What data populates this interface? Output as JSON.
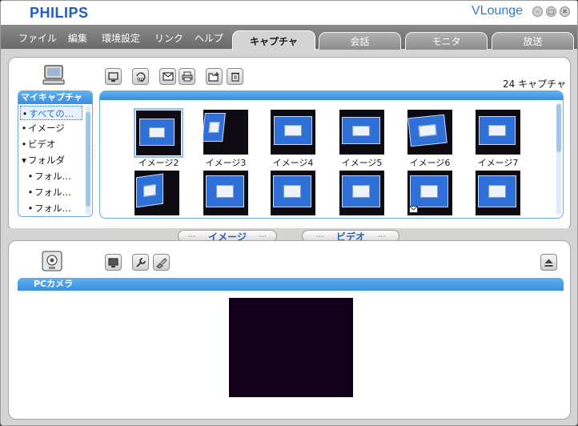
{
  "brand": "PHILIPS",
  "app_title": "VLounge",
  "menu": [
    "ファイル",
    "編集",
    "環境設定",
    "リンク",
    "ヘルプ"
  ],
  "tabs": [
    {
      "label": "キャプチャ",
      "active": true
    },
    {
      "label": "会話",
      "active": false
    },
    {
      "label": "モニタ",
      "active": false
    },
    {
      "label": "放送",
      "active": false
    }
  ],
  "capture": {
    "count_label": "24 キャプチャ",
    "sidebar": {
      "title": "マイキャプチャ",
      "items": [
        "すべての…",
        "イメージ",
        "ビデオ",
        "フォルダ",
        "フォル…",
        "フォル…",
        "フォル…"
      ]
    },
    "thumbnails": [
      "イメージ2",
      "イメージ3",
      "イメージ4",
      "イメージ5",
      "イメージ6",
      "イメージ7"
    ],
    "selected_thumbnail": "イメージ2"
  },
  "toggle": {
    "image_label": "イメージ",
    "video_label": "ビデオ"
  },
  "camera": {
    "title": "PCカメラ"
  },
  "colors": {
    "accent": "#3a8fdc",
    "brand": "#1f5fc0",
    "camera_preview": "#12001a"
  }
}
